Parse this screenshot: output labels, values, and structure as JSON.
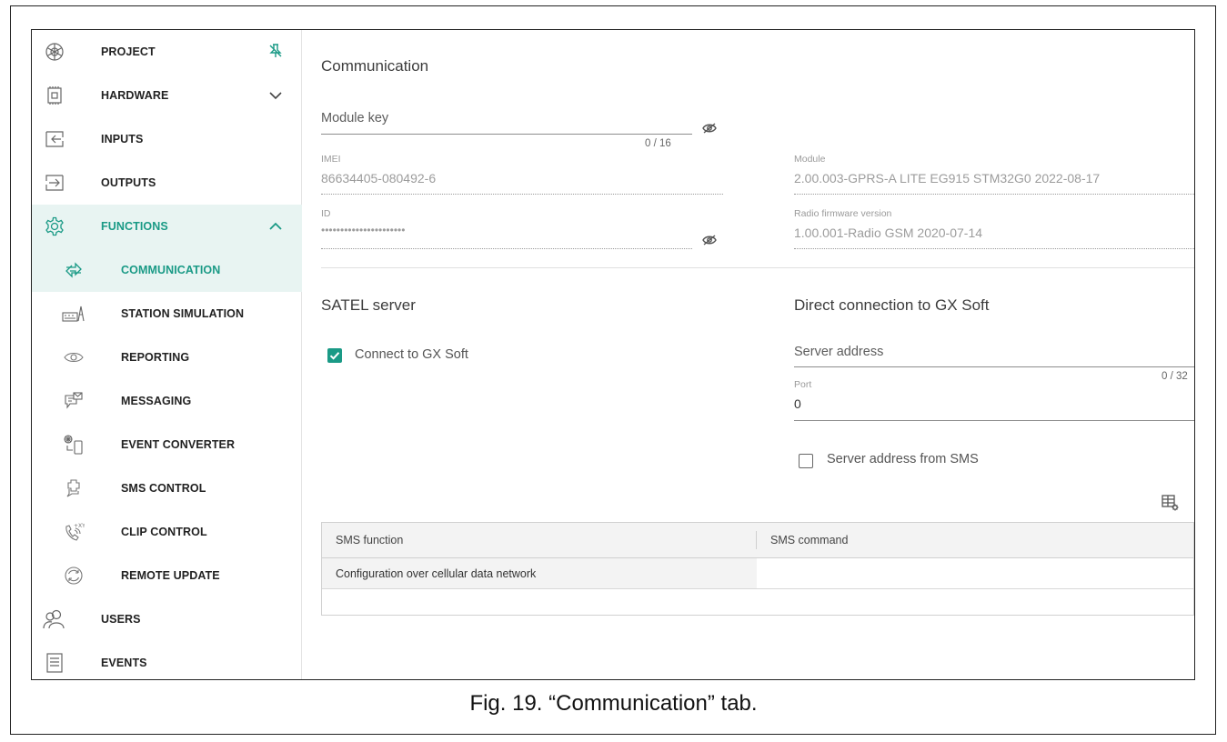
{
  "sidebar": {
    "items": [
      {
        "label": "PROJECT",
        "icon": "project-icon",
        "trail": "pin-icon"
      },
      {
        "label": "HARDWARE",
        "icon": "hardware-icon",
        "trail": "chevron-down-icon"
      },
      {
        "label": "INPUTS",
        "icon": "inputs-icon"
      },
      {
        "label": "OUTPUTS",
        "icon": "outputs-icon"
      },
      {
        "label": "FUNCTIONS",
        "icon": "functions-gear-icon",
        "trail": "chevron-up-icon"
      },
      {
        "label": "COMMUNICATION",
        "icon": "communication-icon",
        "selected": true
      },
      {
        "label": "STATION SIMULATION",
        "icon": "station-simulation-icon"
      },
      {
        "label": "REPORTING",
        "icon": "reporting-eye-icon"
      },
      {
        "label": "MESSAGING",
        "icon": "messaging-icon"
      },
      {
        "label": "EVENT CONVERTER",
        "icon": "event-converter-icon"
      },
      {
        "label": "SMS CONTROL",
        "icon": "sms-control-icon"
      },
      {
        "label": "CLIP CONTROL",
        "icon": "clip-control-icon"
      },
      {
        "label": "REMOTE UPDATE",
        "icon": "remote-update-icon"
      },
      {
        "label": "USERS",
        "icon": "users-icon"
      },
      {
        "label": "EVENTS",
        "icon": "events-icon"
      }
    ]
  },
  "communication": {
    "title": "Communication",
    "module_key": {
      "placeholder": "Module key",
      "counter": "0 / 16"
    },
    "imei": {
      "label": "IMEI",
      "value": "86634405-080492-6"
    },
    "id": {
      "label": "ID",
      "value": "••••••••••••••••••••••"
    },
    "module": {
      "label": "Module",
      "value": "2.00.003-GPRS-A LITE EG915 STM32G0 2022-08-17"
    },
    "radio_fw": {
      "label": "Radio firmware version",
      "value": "1.00.001-Radio GSM 2020-07-14"
    }
  },
  "satel_server": {
    "title": "SATEL server",
    "connect_label": "Connect to GX Soft",
    "connect_checked": true
  },
  "direct_connection": {
    "title": "Direct connection to GX Soft",
    "server_address": {
      "placeholder": "Server address",
      "counter": "0 / 32"
    },
    "port": {
      "label": "Port",
      "value": "0"
    },
    "from_sms_label": "Server address from SMS",
    "from_sms_checked": false
  },
  "sms_table": {
    "columns": [
      "SMS function",
      "SMS command"
    ],
    "rows": [
      {
        "function": "Configuration over cellular data network",
        "command": ""
      }
    ]
  },
  "caption": "Fig. 19. “Communication” tab.",
  "colors": {
    "accent": "#1a9a86",
    "accent_bg": "#e8f4f2"
  }
}
